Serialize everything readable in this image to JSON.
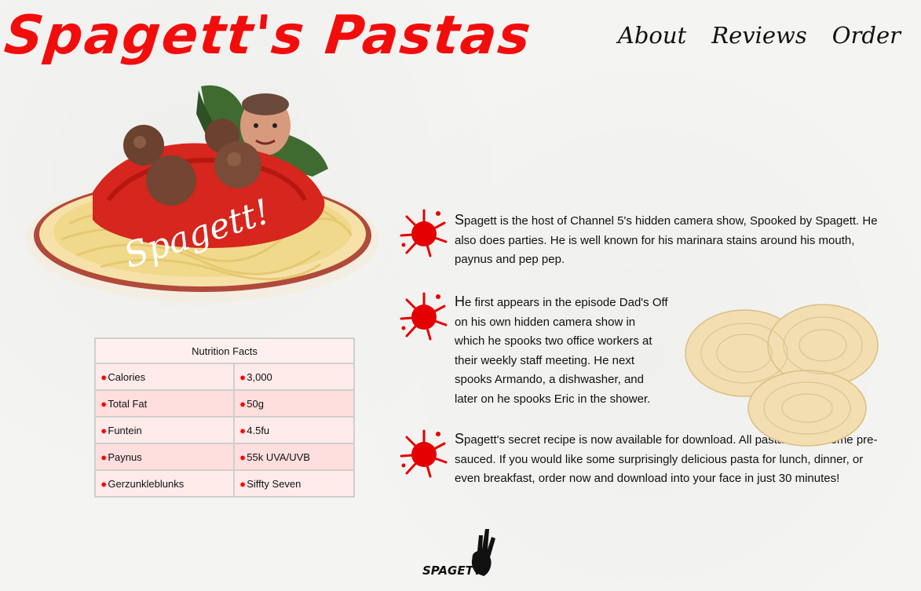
{
  "site": {
    "title": "Spagett's Pastas"
  },
  "nav": [
    {
      "label": "About"
    },
    {
      "label": "Reviews"
    },
    {
      "label": "Order"
    }
  ],
  "hero": {
    "caption": "Spagett!"
  },
  "nutrition": {
    "title": "Nutrition Facts",
    "rows": [
      {
        "name": "Calories",
        "value": "3,000"
      },
      {
        "name": "Total Fat",
        "value": "50g"
      },
      {
        "name": "Funtein",
        "value": "4.5fu"
      },
      {
        "name": "Paynus",
        "value": "55k UVA/UVB"
      },
      {
        "name": "Gerzunkleblunks",
        "value": "Siffty Seven"
      }
    ]
  },
  "paragraphs": [
    {
      "first": "S",
      "rest": "pagett is the host of Channel 5's hidden camera show, Spooked by Spagett. He also does parties. He is well known for his marinara stains around his mouth, paynus and pep pep."
    },
    {
      "first": "H",
      "rest": "e first appears in the episode Dad's Off on his own hidden camera show in which he spooks two office workers at their weekly staff meeting. He next spooks Armando, a dishwasher, and later on he spooks Eric in the shower."
    },
    {
      "first": "S",
      "rest": "pagett's secret recipe is now available for download. All pasta dishes come pre-sauced. If you would like some surprisingly delicious pasta for lunch, dinner, or even breakfast, order now and download into your face in just 30 minutes!"
    }
  ],
  "footer": {
    "logo_text": "SPAGETT!"
  },
  "colors": {
    "brand": "#f20d0d",
    "splat": "#e40000"
  }
}
